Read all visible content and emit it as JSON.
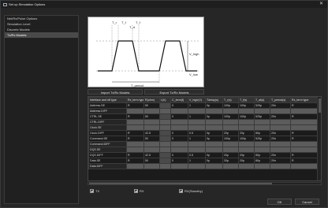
{
  "window": {
    "title": "Set up Simulation Options",
    "close_glyph": "✕"
  },
  "sidebar": {
    "items": [
      {
        "label": "Net/Rx/Pulse Options",
        "active": false
      },
      {
        "label": "Simulation Level",
        "active": false
      },
      {
        "label": "Discrete Models",
        "active": false
      },
      {
        "label": "Tx/Rx Models",
        "active": true
      }
    ]
  },
  "diagram": {
    "labels": {
      "tr": "T_r",
      "tf": "T_f",
      "tr2": "T_rt",
      "tf2": "T_f",
      "high": "V_high",
      "low": "V_low",
      "period": "T_period"
    }
  },
  "buttons": {
    "import": "Import Tx/Rx Models",
    "export": "Export Tx/Rx Models",
    "ok": "OK",
    "cancel": "Cancel"
  },
  "table": {
    "headers": [
      "Interface and nft type",
      "Rx_term type",
      "R(ohm)",
      "L(h)",
      "C_term(f)",
      "V_high(V)",
      "Tdelay(s)",
      "T_r(s)",
      "T_f(s)",
      "T_at(s)",
      "T_period(s)",
      "Rx_term type"
    ],
    "rows": [
      {
        "cells": [
          "Address.SE",
          "R",
          "50",
          "",
          "0",
          "1",
          "0p",
          "100p",
          "100p",
          "525p",
          "20n",
          "R"
        ],
        "diff": false
      },
      {
        "cells": [
          "Address.DIFF",
          "",
          "",
          "",
          "",
          "",
          "",
          "",
          "",
          "",
          "",
          ""
        ],
        "diff": true
      },
      {
        "cells": [
          "CTRL.SE",
          "R",
          "50",
          "",
          "0",
          "1",
          "0p",
          "100p",
          "100p",
          "525p",
          "20n",
          "R"
        ],
        "diff": false
      },
      {
        "cells": [
          "CTRL.DIFF",
          "",
          "",
          "",
          "",
          "",
          "",
          "",
          "",
          "",
          "",
          ""
        ],
        "diff": true
      },
      {
        "cells": [
          "Clock.SE",
          "",
          "",
          "",
          "",
          "",
          "",
          "",
          "",
          "",
          "",
          ""
        ],
        "diff": true
      },
      {
        "cells": [
          "Clock.DIFF",
          "R",
          "42.5",
          "",
          "0",
          "0.5",
          "0p",
          "20p",
          "20p",
          "80p",
          "20n",
          "R"
        ],
        "diff": false
      },
      {
        "cells": [
          "Command.SE",
          "R",
          "50",
          "",
          "0",
          "1",
          "0p",
          "100p",
          "100p",
          "525p",
          "20n",
          "R"
        ],
        "diff": false
      },
      {
        "cells": [
          "Command.DIFF",
          "",
          "",
          "",
          "",
          "",
          "",
          "",
          "",
          "",
          "",
          ""
        ],
        "diff": true
      },
      {
        "cells": [
          "DQS.SE",
          "",
          "",
          "",
          "",
          "",
          "",
          "",
          "",
          "",
          "",
          ""
        ],
        "diff": true
      },
      {
        "cells": [
          "DQS.DIFF",
          "R",
          "42.5",
          "",
          "0",
          "0.5",
          "0p",
          "20p",
          "20p",
          "80p",
          "20n",
          "R"
        ],
        "diff": false
      },
      {
        "cells": [
          "Data.SE",
          "R",
          "50",
          "",
          "0",
          "1",
          "0p",
          "20p",
          "20p",
          "80p",
          "20n",
          "R"
        ],
        "diff": false
      },
      {
        "cells": [
          "Data.DIFF",
          "",
          "",
          "",
          "",
          "",
          "",
          "",
          "",
          "",
          "",
          ""
        ],
        "diff": true
      }
    ]
  },
  "checks": {
    "tx": "TX",
    "rx": "RX",
    "rx_standby": "RX(Standby)"
  }
}
